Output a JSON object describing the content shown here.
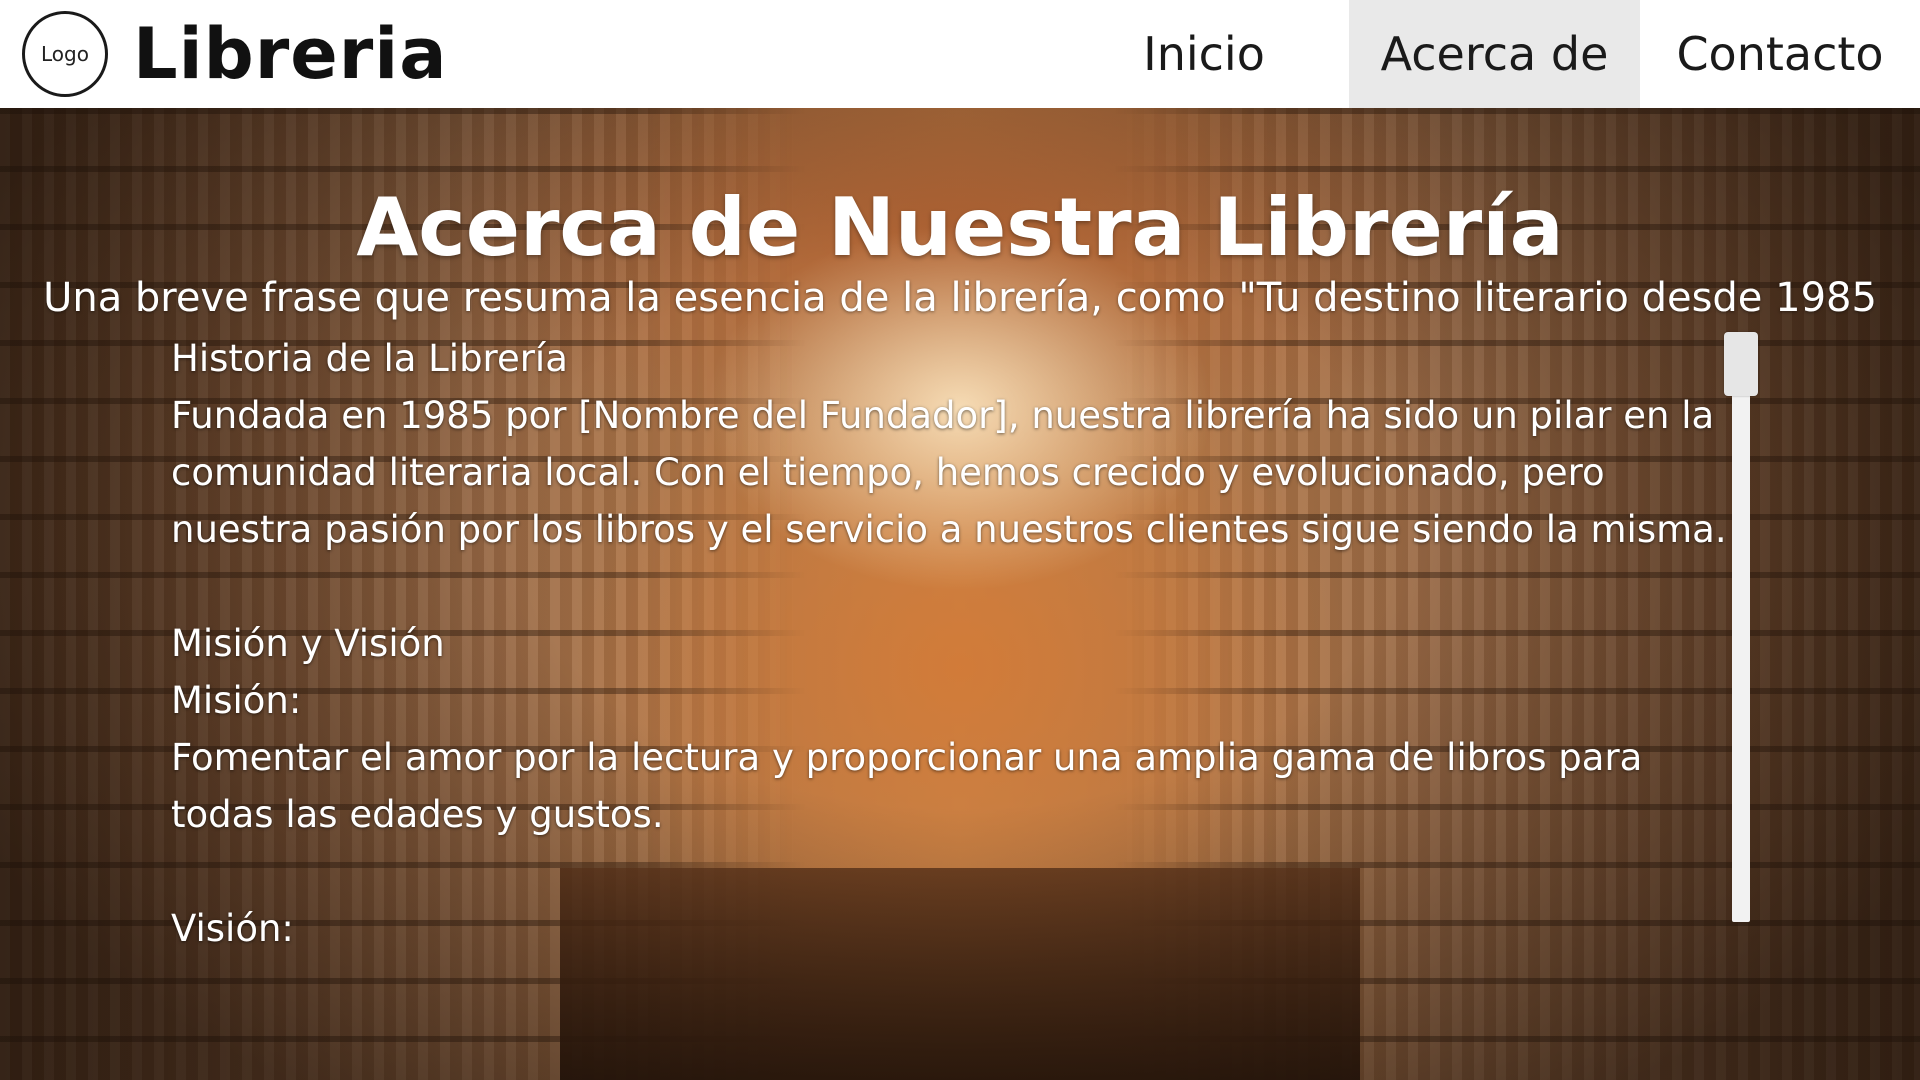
{
  "header": {
    "logo_text": "Logo",
    "brand": "Libreria",
    "nav": [
      {
        "label": "Inicio"
      },
      {
        "label": "Acerca de",
        "active": true
      },
      {
        "label": "Contacto"
      }
    ]
  },
  "hero": {
    "title": "Acerca de Nuestra Librería",
    "subtitle": "Una breve frase que resuma la esencia de la librería, como \"Tu destino literario desde 1985"
  },
  "content": {
    "history_heading": "Historia de la Librería",
    "history_text": "Fundada en 1985 por [Nombre del Fundador], nuestra librería ha sido un pilar en la comunidad literaria local. Con el tiempo, hemos crecido y evolucionado, pero nuestra pasión por los libros y el servicio a nuestros clientes sigue siendo la misma.",
    "mission_vision_heading": "Misión y Visión",
    "mission_label": "Misión:",
    "mission_text": "Fomentar el amor por la lectura y proporcionar una amplia gama de libros para todas las edades y gustos.",
    "vision_label": "Visión:"
  },
  "colors": {
    "header_bg": "#ffffff",
    "active_nav_bg": "#e9e9e9",
    "text_on_hero": "#ffffff"
  }
}
